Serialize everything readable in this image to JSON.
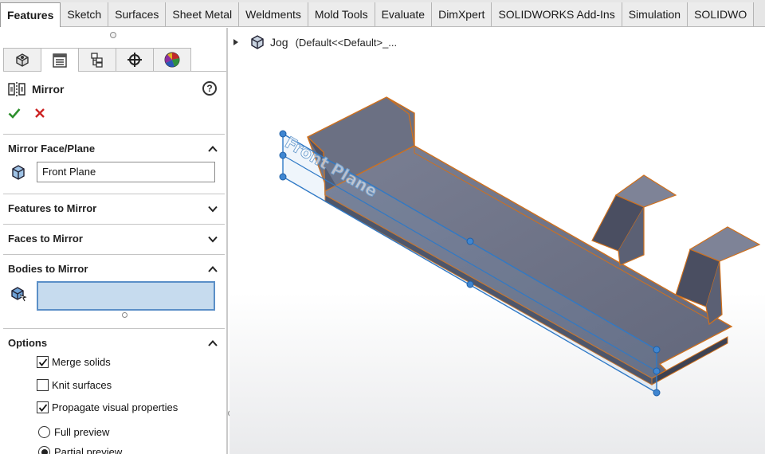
{
  "tabs": [
    "Features",
    "Sketch",
    "Surfaces",
    "Sheet Metal",
    "Weldments",
    "Mold Tools",
    "Evaluate",
    "DimXpert",
    "SOLIDWORKS Add-Ins",
    "Simulation",
    "SOLIDWO"
  ],
  "manager_tabs": [
    "feature-manager",
    "property-manager",
    "configuration-manager",
    "dimxpert-manager",
    "display-manager"
  ],
  "property_manager": {
    "title": "Mirror",
    "help": "?",
    "mirror_face": {
      "title": "Mirror Face/Plane",
      "value": "Front Plane"
    },
    "features_title": "Features to Mirror",
    "faces_title": "Faces to Mirror",
    "bodies": {
      "title": "Bodies to Mirror",
      "value": ""
    },
    "options": {
      "title": "Options",
      "merge_solids": "Merge solids",
      "merge_solids_checked": true,
      "knit_surfaces": "Knit surfaces",
      "knit_surfaces_checked": false,
      "propagate": "Propagate visual properties",
      "propagate_checked": true,
      "full_preview": "Full preview",
      "partial_preview": "Partial preview",
      "selected_preview": "partial"
    }
  },
  "feature_tree": {
    "part_name": "Jog",
    "configuration": "(Default<<Default>_..."
  },
  "viewport": {
    "plane_label": "Front Plane"
  },
  "colors": {
    "accent": "#5b8fc7",
    "selection_fill": "#c6dbee",
    "plane_edge": "#2f79c6",
    "model_edge": "#d0701c",
    "model_face": "#6b7083",
    "check_green": "#2d8f2d",
    "cancel_red": "#cc2222"
  }
}
